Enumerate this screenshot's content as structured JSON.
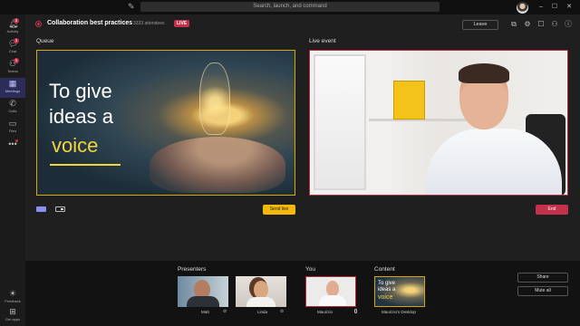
{
  "titlebar": {
    "search_placeholder": "Search, launch, and command"
  },
  "rail": {
    "items": [
      {
        "label": "Activity",
        "badge": "2"
      },
      {
        "label": "Chat",
        "badge": "1"
      },
      {
        "label": "Teams",
        "badge": "1"
      },
      {
        "label": "Meetings",
        "badge": ""
      },
      {
        "label": "Calls",
        "badge": ""
      },
      {
        "label": "Files",
        "badge": ""
      }
    ],
    "bottom": [
      {
        "label": "Feedback"
      },
      {
        "label": "Get apps"
      }
    ]
  },
  "event": {
    "title": "Collaboration best practices",
    "attendees": "3333 attendees",
    "live_badge": "LIVE",
    "leave_label": "Leave"
  },
  "queue": {
    "label": "Queue",
    "slide_lines": [
      "To give",
      "ideas a",
      "voice"
    ],
    "send_live_label": "Send live"
  },
  "live": {
    "label": "Live event",
    "end_label": "End"
  },
  "presenters": {
    "label": "Presenters",
    "people": [
      {
        "name": "Matt"
      },
      {
        "name": "Linda"
      }
    ]
  },
  "you": {
    "label": "You",
    "name": "Maurizio"
  },
  "content": {
    "label": "Content",
    "name": "Maurizio's Desktop",
    "thumb_lines": [
      "To give",
      "ideas a",
      "voice"
    ]
  },
  "actions": {
    "share_label": "Share",
    "mute_label": "Mute all"
  }
}
